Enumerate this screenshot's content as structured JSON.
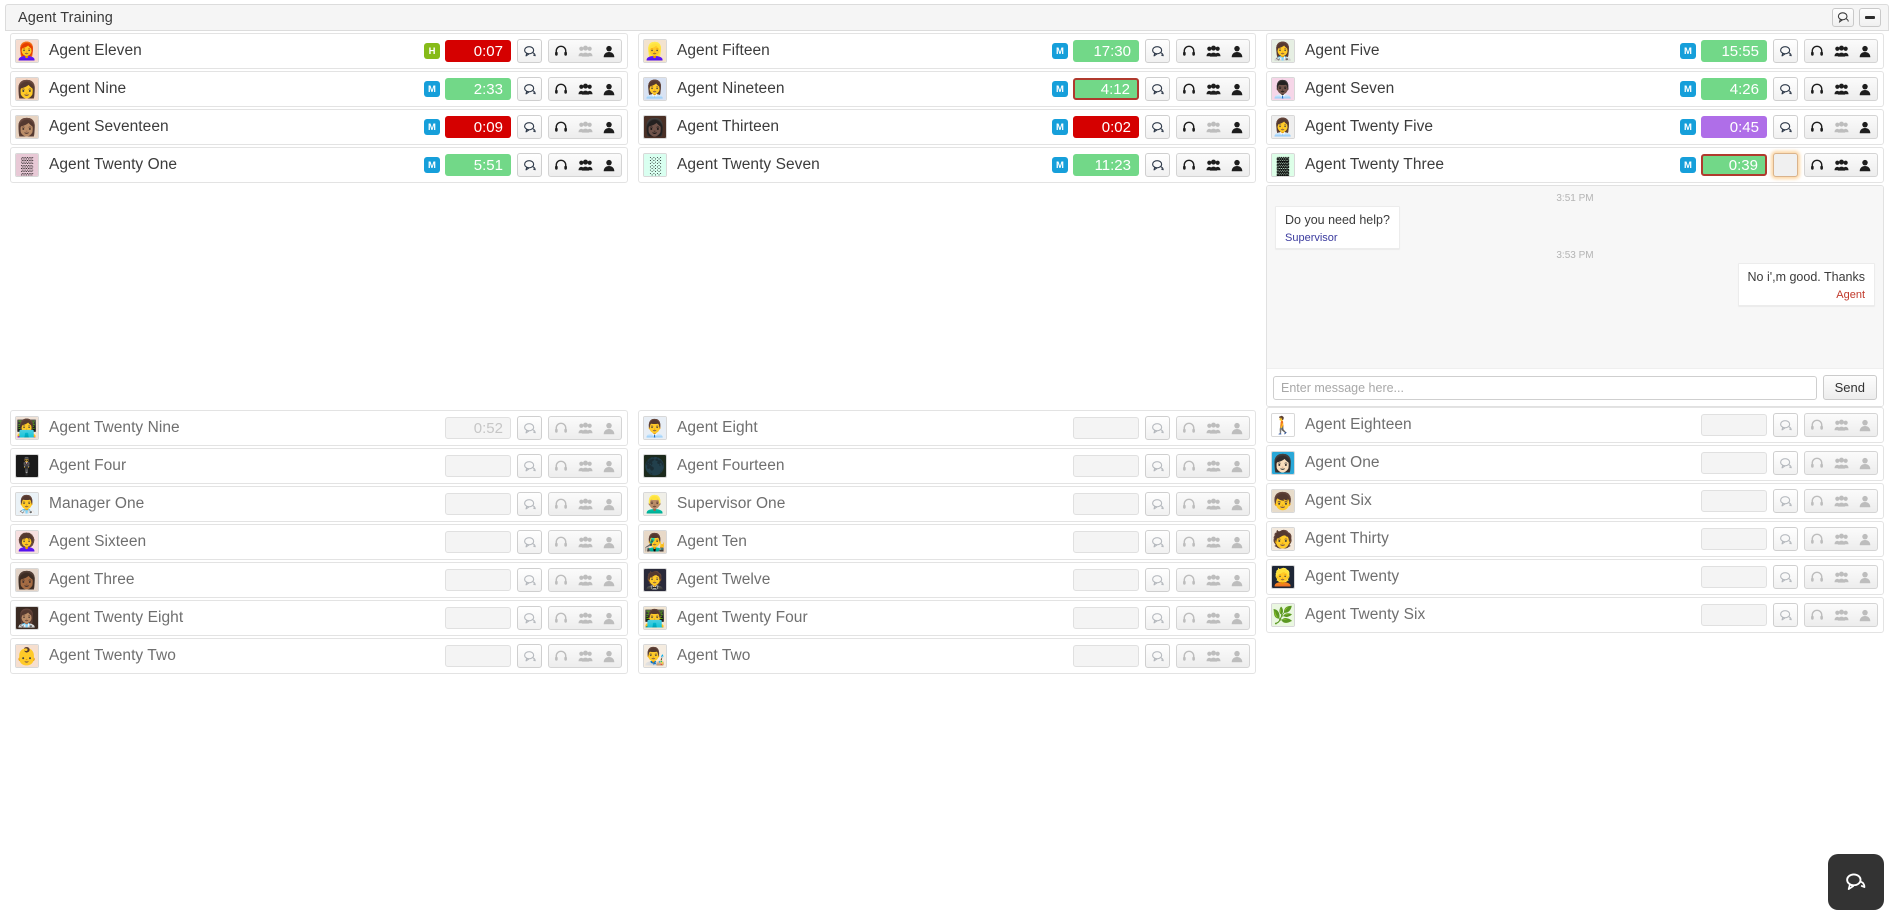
{
  "window": {
    "title": "Agent Training",
    "actions": [
      {
        "name": "chat-toggle",
        "icon": "chat-bubble-icon"
      },
      {
        "name": "minimize",
        "icon": "minimize-icon"
      }
    ]
  },
  "colors": {
    "priority_m": "#169fda",
    "priority_h": "#86bb19",
    "timer_red": "#d50000",
    "timer_green": "#72d888",
    "timer_purple": "#af6ee8",
    "timer_idle": "#f4f4f4",
    "selected_border": "#b03a2e",
    "focus_ring": "#fab45a",
    "supervisor_label": "#3a3a9e",
    "agent_label": "#c0392b",
    "launcher_bg": "#333333"
  },
  "row_icons": {
    "chat": "chat-bubble-icon",
    "headset": "headset-icon",
    "group": "group-icon",
    "person": "person-icon"
  },
  "active": {
    "col1": [
      {
        "name": "Agent Eleven",
        "priority": "H",
        "timer": "0:07",
        "timer_state": "red",
        "avatar": "👩‍🦰",
        "avatar_bg": "#f6dcd0",
        "headset_on": true,
        "group_on": false,
        "person_on": true
      },
      {
        "name": "Agent Nine",
        "priority": "M",
        "timer": "2:33",
        "timer_state": "green",
        "avatar": "👩",
        "avatar_bg": "#f2d6c6",
        "headset_on": true,
        "group_on": true,
        "person_on": true
      },
      {
        "name": "Agent Seventeen",
        "priority": "M",
        "timer": "0:09",
        "timer_state": "red",
        "avatar": "👩🏽",
        "avatar_bg": "#e8d4c2",
        "headset_on": true,
        "group_on": false,
        "person_on": true
      },
      {
        "name": "Agent Twenty One",
        "priority": "M",
        "timer": "5:51",
        "timer_state": "green",
        "avatar": "▒",
        "avatar_bg": "#e8c9d6",
        "headset_on": true,
        "group_on": true,
        "person_on": true
      }
    ],
    "col2": [
      {
        "name": "Agent Fifteen",
        "priority": "M",
        "timer": "17:30",
        "timer_state": "green",
        "avatar": "👱‍♀️",
        "avatar_bg": "#f3e3cf",
        "headset_on": true,
        "group_on": true,
        "person_on": true
      },
      {
        "name": "Agent Nineteen",
        "priority": "M",
        "timer": "4:12",
        "timer_state": "green",
        "timer_selected": true,
        "avatar": "👩‍💼",
        "avatar_bg": "#d9e2f2",
        "headset_on": true,
        "group_on": true,
        "person_on": true
      },
      {
        "name": "Agent Thirteen",
        "priority": "M",
        "timer": "0:02",
        "timer_state": "red",
        "avatar": "👩🏿",
        "avatar_bg": "#4a3026",
        "headset_on": true,
        "group_on": false,
        "person_on": true
      },
      {
        "name": "Agent Twenty Seven",
        "priority": "M",
        "timer": "11:23",
        "timer_state": "green",
        "avatar": "░",
        "avatar_bg": "#d9fff0",
        "headset_on": true,
        "group_on": true,
        "person_on": true
      }
    ],
    "col3": [
      {
        "name": "Agent Five",
        "priority": "M",
        "timer": "15:55",
        "timer_state": "green",
        "avatar": "👩‍⚕️",
        "avatar_bg": "#e6efe3",
        "headset_on": true,
        "group_on": true,
        "person_on": true
      },
      {
        "name": "Agent Seven",
        "priority": "M",
        "timer": "4:26",
        "timer_state": "green",
        "avatar": "👨🏿‍💼",
        "avatar_bg": "#f6d6e8",
        "headset_on": true,
        "group_on": true,
        "person_on": true
      },
      {
        "name": "Agent Twenty Five",
        "priority": "M",
        "timer": "0:45",
        "timer_state": "purple",
        "avatar": "👩‍💼",
        "avatar_bg": "#efefef",
        "headset_on": true,
        "group_on": false,
        "person_on": true
      },
      {
        "name": "Agent Twenty Three",
        "priority": "M",
        "timer": "0:39",
        "timer_state": "green",
        "timer_selected": true,
        "chat_focused": true,
        "chat_blank": true,
        "avatar": "▓",
        "avatar_bg": "#ddffe8",
        "headset_on": true,
        "group_on": true,
        "person_on": true
      }
    ]
  },
  "chat": {
    "agent_name": "Agent Twenty Three",
    "messages": [
      {
        "time": "3:51 PM",
        "text": "Do you need help?",
        "who": "Supervisor",
        "side": "left"
      },
      {
        "time": "3:53 PM",
        "text": "No i',m good. Thanks",
        "who": "Agent",
        "side": "right"
      }
    ],
    "input_placeholder": "Enter message here...",
    "input_value": "",
    "send_label": "Send"
  },
  "offline": {
    "col1": [
      {
        "name": "Agent Twenty Nine",
        "timer": "0:52",
        "timer_state": "idle",
        "avatar": "👩‍💻",
        "avatar_bg": "#f0e2d6",
        "headset_on": false,
        "group_on": false,
        "person_on": false
      },
      {
        "name": "Agent Four",
        "timer": "",
        "timer_state": "blank",
        "avatar": "🕴️",
        "avatar_bg": "#1a1a1a",
        "headset_on": false,
        "group_on": false,
        "person_on": false
      },
      {
        "name": "Manager One",
        "timer": "",
        "timer_state": "blank",
        "avatar": "👨‍⚕️",
        "avatar_bg": "#eaf2f7",
        "headset_on": false,
        "group_on": false,
        "person_on": false
      },
      {
        "name": "Agent Sixteen",
        "timer": "",
        "timer_state": "blank",
        "avatar": "👩‍🦱",
        "avatar_bg": "#f7e0e0",
        "headset_on": false,
        "group_on": false,
        "person_on": false
      },
      {
        "name": "Agent Three",
        "timer": "",
        "timer_state": "blank",
        "avatar": "👩🏾",
        "avatar_bg": "#e3d4c8",
        "headset_on": false,
        "group_on": false,
        "person_on": false
      },
      {
        "name": "Agent Twenty Eight",
        "timer": "",
        "timer_state": "blank",
        "avatar": "👩🏽‍⚕️",
        "avatar_bg": "#3a2a22",
        "headset_on": false,
        "group_on": false,
        "person_on": false
      },
      {
        "name": "Agent Twenty Two",
        "timer": "",
        "timer_state": "blank",
        "avatar": "👶",
        "avatar_bg": "#f6dfcf",
        "headset_on": false,
        "group_on": false,
        "person_on": false
      }
    ],
    "col2": [
      {
        "name": "Agent Eight",
        "timer": "",
        "timer_state": "blank",
        "avatar": "👨‍💼",
        "avatar_bg": "#e8eef5",
        "headset_on": false,
        "group_on": false,
        "person_on": false
      },
      {
        "name": "Agent Fourteen",
        "timer": "",
        "timer_state": "blank",
        "avatar": "🌑",
        "avatar_bg": "#1c2a1c",
        "headset_on": false,
        "group_on": false,
        "person_on": false
      },
      {
        "name": "Supervisor One",
        "timer": "",
        "timer_state": "blank",
        "avatar": "👱🏽‍♂️",
        "avatar_bg": "#f0efe8",
        "headset_on": false,
        "group_on": false,
        "person_on": false
      },
      {
        "name": "Agent Ten",
        "timer": "",
        "timer_state": "blank",
        "avatar": "👨‍🎤",
        "avatar_bg": "#e8d9c8",
        "headset_on": false,
        "group_on": false,
        "person_on": false
      },
      {
        "name": "Agent Twelve",
        "timer": "",
        "timer_state": "blank",
        "avatar": "🤵",
        "avatar_bg": "#2a2a3a",
        "headset_on": false,
        "group_on": false,
        "person_on": false
      },
      {
        "name": "Agent Twenty Four",
        "timer": "",
        "timer_state": "blank",
        "avatar": "👨‍💻",
        "avatar_bg": "#f2e6d2",
        "headset_on": false,
        "group_on": false,
        "person_on": false
      },
      {
        "name": "Agent Two",
        "timer": "",
        "timer_state": "blank",
        "avatar": "👨‍🎨",
        "avatar_bg": "#f5ece0",
        "headset_on": false,
        "group_on": false,
        "person_on": false
      }
    ],
    "col3": [
      {
        "name": "Agent Eighteen",
        "timer": "",
        "timer_state": "blank",
        "avatar": "🚶",
        "avatar_bg": "#ffffff",
        "headset_on": false,
        "group_on": false,
        "person_on": false
      },
      {
        "name": "Agent One",
        "timer": "",
        "timer_state": "blank",
        "avatar": "👩🏻",
        "avatar_bg": "#2aa8d8",
        "headset_on": false,
        "group_on": false,
        "person_on": false
      },
      {
        "name": "Agent Six",
        "timer": "",
        "timer_state": "blank",
        "avatar": "👦",
        "avatar_bg": "#e7dccb",
        "headset_on": false,
        "group_on": false,
        "person_on": false
      },
      {
        "name": "Agent Thirty",
        "timer": "",
        "timer_state": "blank",
        "avatar": "🧑",
        "avatar_bg": "#f3e9dd",
        "headset_on": false,
        "group_on": false,
        "person_on": false
      },
      {
        "name": "Agent Twenty",
        "timer": "",
        "timer_state": "blank",
        "avatar": "👱",
        "avatar_bg": "#1f2736",
        "headset_on": false,
        "group_on": false,
        "person_on": false
      },
      {
        "name": "Agent Twenty Six",
        "timer": "",
        "timer_state": "blank",
        "avatar": "🌿",
        "avatar_bg": "#eaf7e0",
        "headset_on": false,
        "group_on": false,
        "person_on": false
      }
    ]
  },
  "launcher": {
    "icon": "chat-bubbles-icon"
  }
}
